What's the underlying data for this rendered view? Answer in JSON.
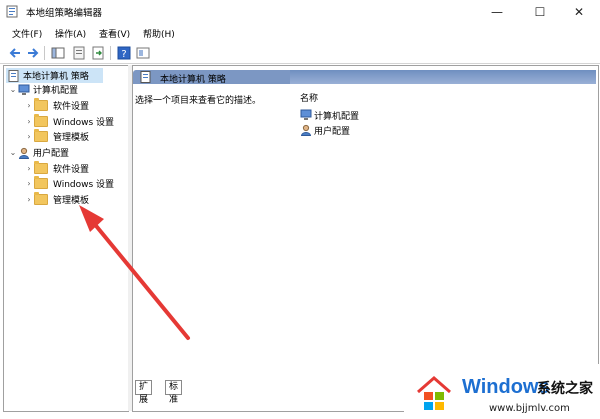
{
  "window": {
    "title": "本地组策略编辑器",
    "controls": {
      "minimize": "—",
      "maximize": "☐",
      "close": "✕"
    }
  },
  "menu": {
    "file": "文件(F)",
    "action": "操作(A)",
    "view": "查看(V)",
    "help": "帮助(H)"
  },
  "tree": {
    "root": "本地计算机 策略",
    "computer": {
      "label": "计算机配置",
      "children": [
        "软件设置",
        "Windows 设置",
        "管理模板"
      ]
    },
    "user": {
      "label": "用户配置",
      "children": [
        "软件设置",
        "Windows 设置",
        "管理模板"
      ]
    }
  },
  "right": {
    "header": "本地计算机 策略",
    "description": "选择一个项目来查看它的描述。",
    "column_name": "名称",
    "items": [
      "计算机配置",
      "用户配置"
    ]
  },
  "tabs": {
    "extended": "扩展",
    "standard": "标准"
  },
  "watermark": {
    "brand": "Windows",
    "subtitle": "系统之家",
    "url": "www.bjjmlv.com"
  },
  "colors": {
    "accent": "#7c97c3",
    "selection": "#cce4f7",
    "annotation_arrow": "#e53935"
  }
}
